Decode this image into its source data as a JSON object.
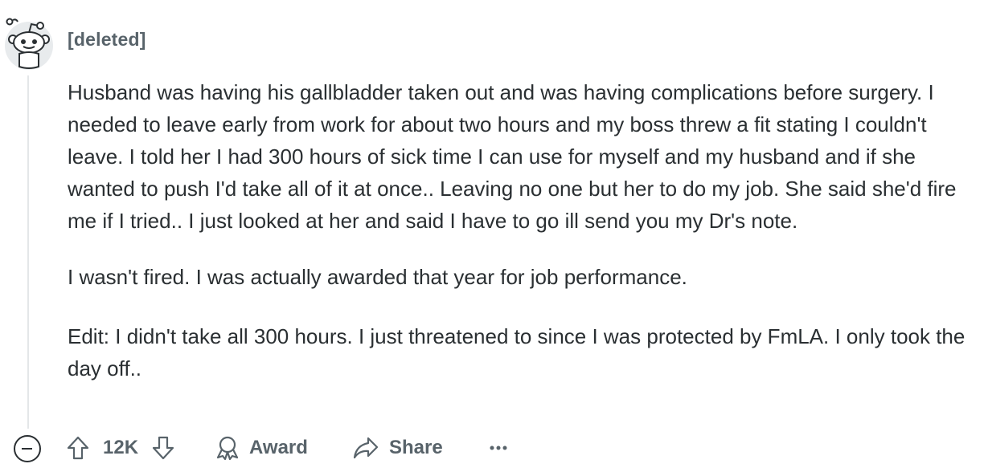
{
  "comment": {
    "author": "[deleted]",
    "paragraphs": [
      "Husband was having his gallbladder taken out and was having complications before surgery. I needed to leave early from work for about two hours and my boss threw a fit stating I couldn't leave. I told her I had 300 hours of sick time I can use for myself and my husband and if she wanted to push I'd take all of it at once.. Leaving no one but her to do my job. She said she'd fire me if I tried.. I just looked at her and said I have to go ill send you my Dr's note.",
      "I wasn't fired. I was actually awarded that year for job performance.",
      "Edit: I didn't take all 300 hours. I just threatened to since I was protected by FmLA. I only took the day off.."
    ]
  },
  "actions": {
    "vote_count": "12K",
    "award_label": "Award",
    "share_label": "Share"
  },
  "icons": {
    "avatar": "snoo-avatar-icon",
    "collapse": "collapse-minus-icon",
    "upvote": "upvote-arrow-icon",
    "downvote": "downvote-arrow-icon",
    "award": "award-ribbon-icon",
    "share": "share-arrow-icon",
    "more": "ellipsis-icon"
  },
  "colors": {
    "meta_text": "#58636a",
    "body_text": "#2a2f32",
    "thread_line": "#e4e7e9",
    "avatar_bg": "#e8ebed"
  }
}
